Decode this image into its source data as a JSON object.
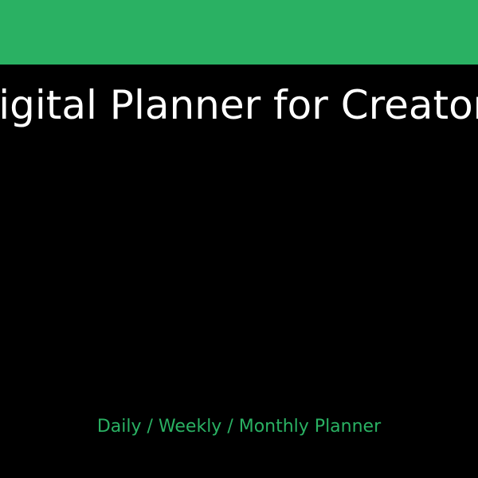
{
  "banner": {
    "title": "Digital Planner for Creators",
    "subtitle": "Daily / Weekly / Monthly Planner"
  },
  "colors": {
    "accent": "#2ab163",
    "background": "#000000",
    "title_text": "#ffffff"
  }
}
